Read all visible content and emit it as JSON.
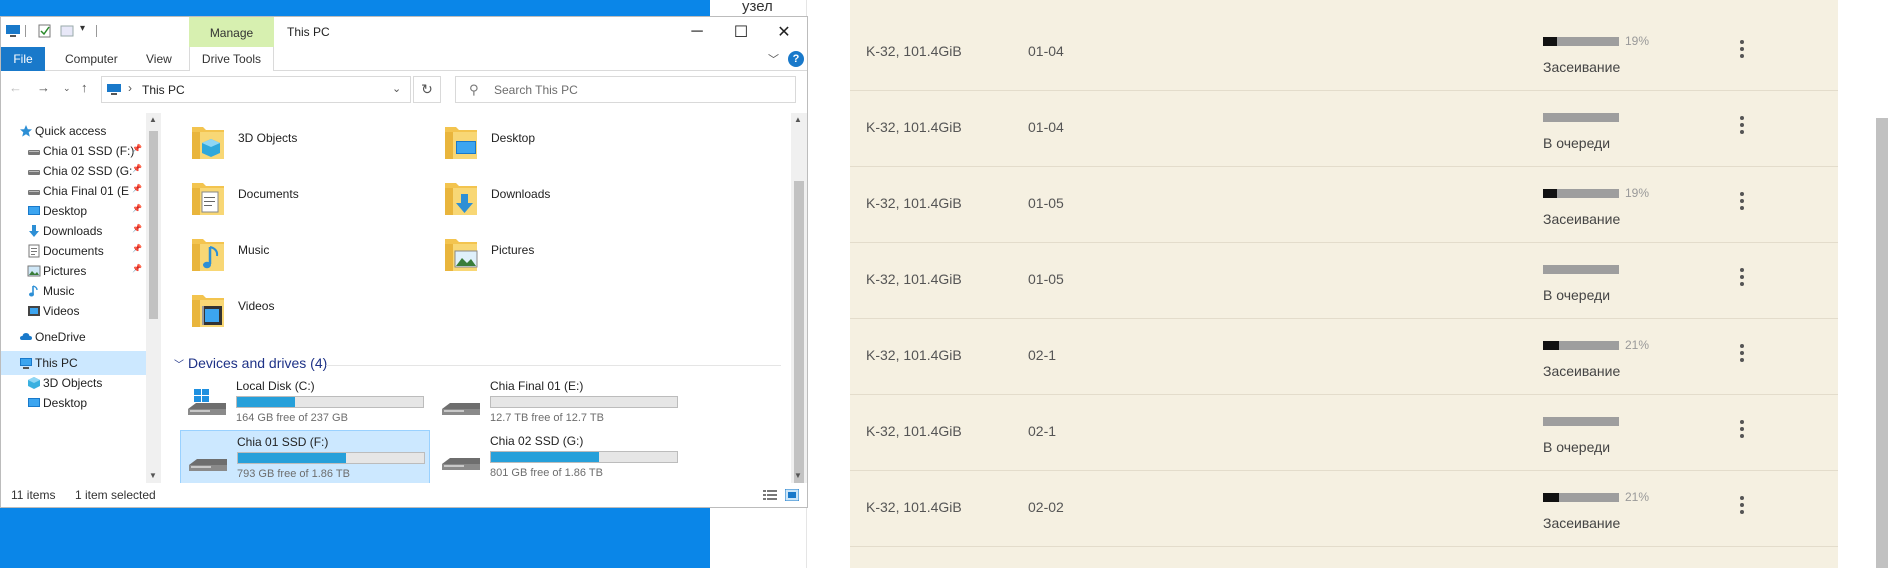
{
  "browser": {
    "node_label": "узел"
  },
  "explorer": {
    "title": "This PC",
    "manage_tab": "Manage",
    "ribbon_tabs": {
      "file": "File",
      "computer": "Computer",
      "view": "View",
      "drive_tools": "Drive Tools"
    },
    "help": "?",
    "address": {
      "separator": "›",
      "path": "This PC"
    },
    "search": {
      "placeholder": "Search This PC"
    },
    "nav": [
      {
        "label": "Quick access",
        "icon": "star-icon",
        "pinned": false
      },
      {
        "label": "Chia 01 SSD (F:)",
        "icon": "drive-icon",
        "pinned": true
      },
      {
        "label": "Chia 02 SSD (G:",
        "icon": "drive-icon",
        "pinned": true
      },
      {
        "label": "Chia Final 01 (E",
        "icon": "drive-icon",
        "pinned": true
      },
      {
        "label": "Desktop",
        "icon": "desktop-icon",
        "pinned": true
      },
      {
        "label": "Downloads",
        "icon": "download-icon",
        "pinned": true
      },
      {
        "label": "Documents",
        "icon": "document-icon",
        "pinned": true
      },
      {
        "label": "Pictures",
        "icon": "picture-icon",
        "pinned": true
      },
      {
        "label": "Music",
        "icon": "music-icon",
        "pinned": false
      },
      {
        "label": "Videos",
        "icon": "video-icon",
        "pinned": false
      },
      {
        "label": "OneDrive",
        "icon": "cloud-icon",
        "pinned": false
      },
      {
        "label": "This PC",
        "icon": "computer-icon",
        "pinned": false,
        "selected": true
      },
      {
        "label": "3D Objects",
        "icon": "cube-icon",
        "pinned": false
      },
      {
        "label": "Desktop",
        "icon": "desktop-icon",
        "pinned": false
      }
    ],
    "pin_glyph": "📌",
    "folders": [
      {
        "label": "3D Objects",
        "icon": "cube-icon"
      },
      {
        "label": "Desktop",
        "icon": "desktop-icon"
      },
      {
        "label": "Documents",
        "icon": "document-icon"
      },
      {
        "label": "Downloads",
        "icon": "download-icon"
      },
      {
        "label": "Music",
        "icon": "music-icon"
      },
      {
        "label": "Pictures",
        "icon": "picture-icon"
      },
      {
        "label": "Videos",
        "icon": "video-icon"
      }
    ],
    "devices_heading": "Devices and drives (4)",
    "drives": [
      {
        "name": "Local Disk (C:)",
        "free": "164 GB free of 237 GB",
        "used_fraction": 0.31,
        "windows": true
      },
      {
        "name": "Chia Final 01 (E:)",
        "free": "12.7 TB free of 12.7 TB",
        "used_fraction": 0.0
      },
      {
        "name": "Chia 01 SSD (F:)",
        "free": "793 GB free of 1.86 TB",
        "used_fraction": 0.58,
        "selected": true
      },
      {
        "name": "Chia 02 SSD (G:)",
        "free": "801 GB free of 1.86 TB",
        "used_fraction": 0.58
      }
    ],
    "status": {
      "items": "11 items",
      "selected": "1 item selected"
    }
  },
  "plots": [
    {
      "k": "K-32, 101.4GiB",
      "queue": "01-04",
      "progress": 19,
      "pct_label": "19%",
      "status": "Засеивание"
    },
    {
      "k": "K-32, 101.4GiB",
      "queue": "01-04",
      "progress": 0,
      "pct_label": "",
      "status": "В очереди"
    },
    {
      "k": "K-32, 101.4GiB",
      "queue": "01-05",
      "progress": 19,
      "pct_label": "19%",
      "status": "Засеивание"
    },
    {
      "k": "K-32, 101.4GiB",
      "queue": "01-05",
      "progress": 0,
      "pct_label": "",
      "status": "В очереди"
    },
    {
      "k": "K-32, 101.4GiB",
      "queue": "02-1",
      "progress": 21,
      "pct_label": "21%",
      "status": "Засеивание"
    },
    {
      "k": "K-32, 101.4GiB",
      "queue": "02-1",
      "progress": 0,
      "pct_label": "",
      "status": "В очереди"
    },
    {
      "k": "K-32, 101.4GiB",
      "queue": "02-02",
      "progress": 21,
      "pct_label": "21%",
      "status": "Засеивание"
    }
  ],
  "colors": {
    "accent": "#1979ca",
    "progress_fill": "#26a0da",
    "plot_panel": "#f5f0e1",
    "desktop": "#0a86e8"
  }
}
